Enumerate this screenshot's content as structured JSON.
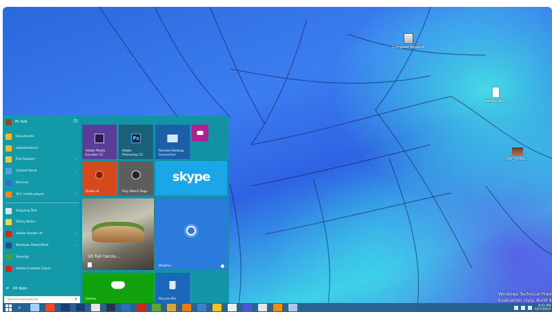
{
  "desktop": {
    "icons": [
      {
        "label": "Computer Network",
        "icon": "computer-icon"
      },
      {
        "label": "sample docx",
        "icon": "document-icon"
      },
      {
        "label": "DW_F5H6L...",
        "icon": "image-file-icon"
      }
    ],
    "watermark": {
      "line1": "Windows Technical Preview",
      "line2": "Evaluation copy. Build 9841"
    }
  },
  "start_menu": {
    "user_name": "Mr Seb",
    "items": [
      {
        "label": "Documents",
        "icon": "folder-icon",
        "color": "#f2b92d",
        "has_arrow": false
      },
      {
        "label": "sebastiantech",
        "icon": "folder-icon",
        "color": "#f2b92d",
        "has_arrow": false
      },
      {
        "label": "File Explorer",
        "icon": "file-explorer-icon",
        "color": "#f0c64a",
        "has_arrow": true
      },
      {
        "label": "Control Panel",
        "icon": "control-panel-icon",
        "color": "#5aa0e0",
        "has_arrow": true
      },
      {
        "label": "Devices",
        "icon": "gear-icon",
        "color": "#2e6fd0",
        "has_arrow": false
      },
      {
        "label": "VLC media player",
        "icon": "vlc-icon",
        "color": "#f08a1c",
        "has_arrow": true
      },
      {
        "label": "Snipping Tool",
        "icon": "scissors-icon",
        "color": "#d9e7f2",
        "has_arrow": false
      },
      {
        "label": "Sticky Notes",
        "icon": "sticky-note-icon",
        "color": "#e8d84a",
        "has_arrow": false
      },
      {
        "label": "Adobe Reader XI",
        "icon": "pdf-icon",
        "color": "#c8281e",
        "has_arrow": true
      },
      {
        "label": "Windows PowerShell",
        "icon": "powershell-icon",
        "color": "#23528c",
        "has_arrow": true
      },
      {
        "label": "Synergy",
        "icon": "synergy-icon",
        "color": "#3aa24a",
        "has_arrow": false
      },
      {
        "label": "Adobe Creative Cloud",
        "icon": "creative-cloud-icon",
        "color": "#d8221a",
        "has_arrow": false
      }
    ],
    "all_apps_label": "All Apps",
    "search_placeholder": "Search everywhere",
    "tiles": {
      "media_encoder": "Adobe Media Encoder CC",
      "photoshop_line1": "Adobe",
      "photoshop_line2": "Photoshop CC",
      "remote_line1": "Remote Desktop",
      "remote_line2": "Connection",
      "diablo": "Diablo III",
      "watch_dogs": "Play Watch Dogs",
      "skype": "skype",
      "food_title": "10 fun tacos...",
      "weather": "Weather",
      "games": "Games",
      "recycle_bin": "Recycle Bin",
      "ps_logo": "Ps"
    }
  },
  "taskbar": {
    "apps": [
      {
        "name": "task-view-icon",
        "color": "#9fd2ff"
      },
      {
        "name": "chrome-icon",
        "color": "#e84a2f"
      },
      {
        "name": "photoshop-icon",
        "color": "#1b3d74"
      },
      {
        "name": "photoshop-icon-2",
        "color": "#1b3d74"
      },
      {
        "name": "file-manager-icon",
        "color": "#dfe6ea"
      },
      {
        "name": "steam-icon",
        "color": "#27344a"
      },
      {
        "name": "media-icon",
        "color": "#2c6fb5"
      },
      {
        "name": "filezilla-icon",
        "color": "#c8281e"
      },
      {
        "name": "greenshot-icon",
        "color": "#5aa83a"
      },
      {
        "name": "app-icon",
        "color": "#d7a642"
      },
      {
        "name": "firefox-icon",
        "color": "#e67c1c"
      },
      {
        "name": "network-icon",
        "color": "#3c82c8"
      },
      {
        "name": "folder-icon",
        "color": "#f2c12e"
      },
      {
        "name": "notepad-icon",
        "color": "#e9eef2"
      },
      {
        "name": "settings-icon",
        "color": "#4a5bd0"
      },
      {
        "name": "recycle-bin-icon",
        "color": "#dfe8ef"
      },
      {
        "name": "vlc-icon",
        "color": "#f08a1c"
      },
      {
        "name": "computer-icon",
        "color": "#a9c8e5"
      }
    ],
    "clock_time": "8:51 PM",
    "clock_date": "10/7/2014"
  }
}
